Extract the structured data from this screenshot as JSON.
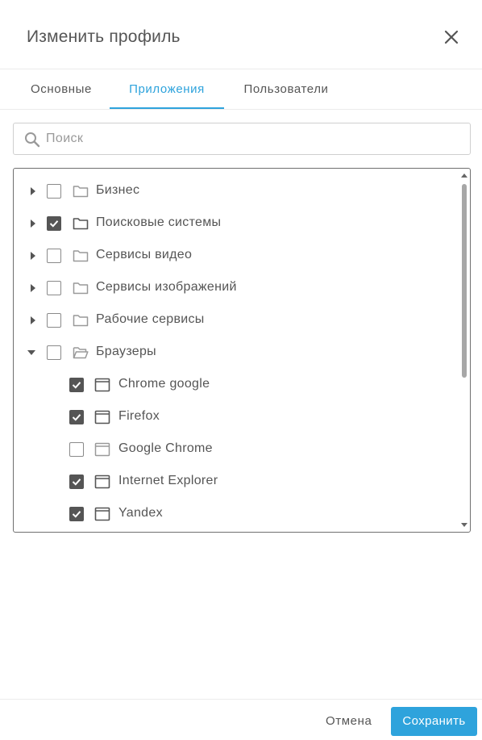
{
  "dialog": {
    "title": "Изменить профиль",
    "close_icon": "close-icon"
  },
  "tabs": [
    {
      "label": "Основные",
      "active": false
    },
    {
      "label": "Приложения",
      "active": true
    },
    {
      "label": "Пользователи",
      "active": false
    }
  ],
  "search": {
    "placeholder": "Поиск",
    "value": ""
  },
  "tree": {
    "groups": [
      {
        "label": "Бизнес",
        "checked": false,
        "expanded": false
      },
      {
        "label": "Поисковые системы",
        "checked": true,
        "expanded": false
      },
      {
        "label": "Сервисы видео",
        "checked": false,
        "expanded": false
      },
      {
        "label": "Сервисы изображений",
        "checked": false,
        "expanded": false
      },
      {
        "label": "Рабочие сервисы",
        "checked": false,
        "expanded": false
      },
      {
        "label": "Браузеры",
        "checked": false,
        "expanded": true,
        "children": [
          {
            "label": "Chrome google",
            "checked": true
          },
          {
            "label": "Firefox",
            "checked": true
          },
          {
            "label": "Google Chrome",
            "checked": false
          },
          {
            "label": "Internet Explorer",
            "checked": true
          },
          {
            "label": "Yandex",
            "checked": true
          }
        ]
      }
    ]
  },
  "footer": {
    "cancel_label": "Отмена",
    "save_label": "Сохранить"
  },
  "colors": {
    "accent": "#2ea3dc",
    "checkbox_checked": "#555555",
    "text": "#555555"
  }
}
